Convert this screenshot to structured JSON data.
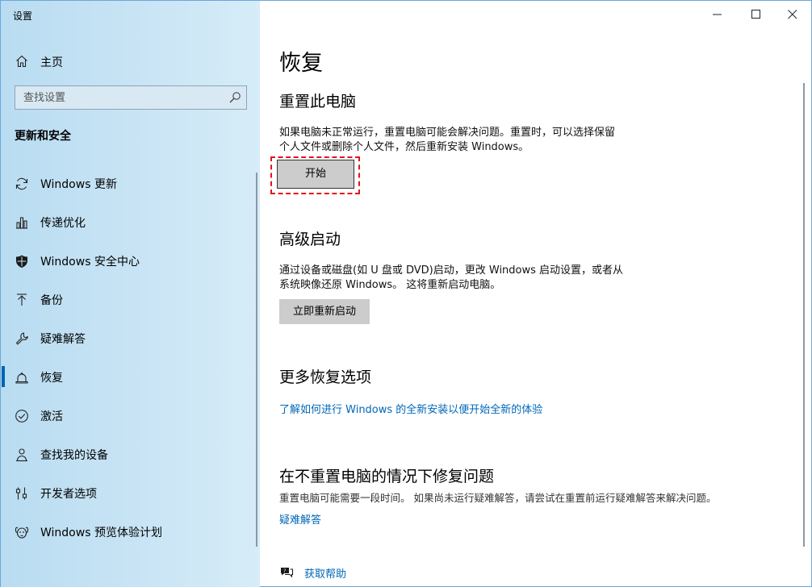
{
  "window": {
    "title": "设置"
  },
  "sidebar": {
    "home_label": "主页",
    "search_placeholder": "查找设置",
    "section_title": "更新和安全",
    "items": [
      {
        "label": "Windows 更新",
        "icon": "sync-icon"
      },
      {
        "label": "传递优化",
        "icon": "delivery-optimization-icon"
      },
      {
        "label": "Windows 安全中心",
        "icon": "shield-icon"
      },
      {
        "label": "备份",
        "icon": "backup-arrow-icon"
      },
      {
        "label": "疑难解答",
        "icon": "wrench-icon"
      },
      {
        "label": "恢复",
        "icon": "recovery-icon",
        "selected": true
      },
      {
        "label": "激活",
        "icon": "check-circle-icon"
      },
      {
        "label": "查找我的设备",
        "icon": "person-location-icon"
      },
      {
        "label": "开发者选项",
        "icon": "developer-icon"
      },
      {
        "label": "Windows 预览体验计划",
        "icon": "insider-icon"
      }
    ]
  },
  "main": {
    "title": "恢复",
    "reset": {
      "heading": "重置此电脑",
      "desc_line1": "如果电脑未正常运行，重置电脑可能会解决问题。重置时，可以选择保留",
      "desc_line2": "个人文件或删除个人文件，然后重新安装 Windows。",
      "button": "开始"
    },
    "advanced": {
      "heading": "高级启动",
      "desc_line1": "通过设备或磁盘(如 U 盘或 DVD)启动，更改 Windows 启动设置，或者从",
      "desc_line2": "系统映像还原 Windows。 这将重新启动电脑。",
      "button": "立即重新启动"
    },
    "more": {
      "heading": "更多恢复选项",
      "link": "了解如何进行 Windows 的全新安装以便开始全新的体验"
    },
    "fix": {
      "heading": "在不重置电脑的情况下修复问题",
      "desc": "重置电脑可能需要一段时间。 如果尚未运行疑难解答，请尝试在重置前运行疑难解答来解决问题。",
      "link": "疑难解答"
    },
    "help": "获取帮助"
  },
  "colors": {
    "accent": "#0067b8",
    "highlight": "#e0151f",
    "sidebar_bg": "#c6e3f4"
  }
}
